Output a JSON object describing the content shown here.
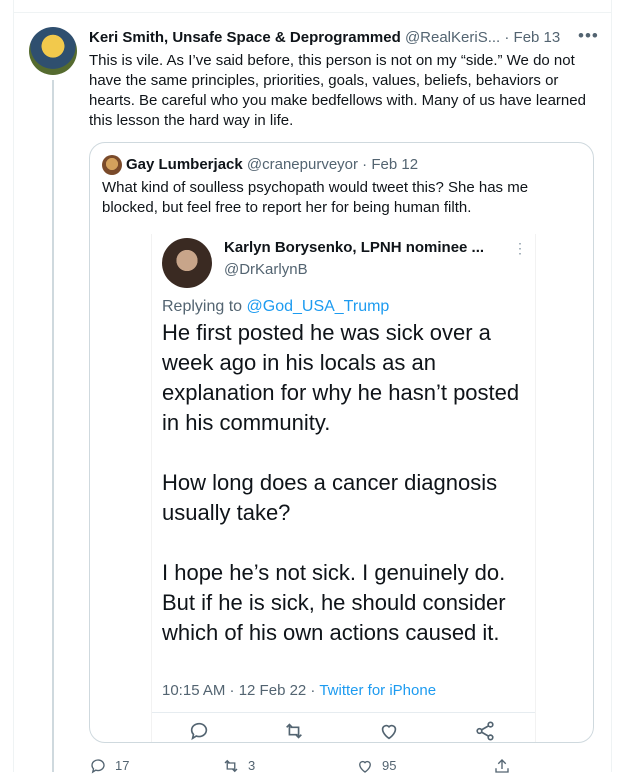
{
  "tweet": {
    "author_name": "Keri Smith, Unsafe Space & Deprogrammed",
    "handle": "@RealKeriS...",
    "dot": "·",
    "date": "Feb 13",
    "text": "This is vile. As I’ve said before, this person is not on my “side.” We do not have the same principles, priorities, goals, values, beliefs, behaviors or hearts. Be careful who you make bedfellows with. Many of us have learned this lesson the hard way in life."
  },
  "quote": {
    "author_name": "Gay Lumberjack",
    "handle": "@cranepurveyor",
    "dot": "·",
    "date": "Feb 12",
    "text": "What kind of soulless psychopath would tweet this? She has me blocked, but feel free to report her for being human filth."
  },
  "screenshot": {
    "author_name": "Karlyn Borysenko, LPNH nominee ...",
    "handle": "@DrKarlynB",
    "replying_prefix": "Replying to",
    "replying_to": "@God_USA_Trump",
    "body": [
      "He first posted he was sick over a week ago in his locals as an explanation for why he hasn’t posted in his community.",
      "How long does a cancer diagnosis usually take?",
      "I hope he’s not sick. I genuinely do. But if he is sick, he should consider which of his own actions caused it."
    ],
    "timestamp": "10:15 AM · 12 Feb 22 ·",
    "source": "Twitter for iPhone",
    "more": "⋮"
  },
  "actions": {
    "reply_count": "17",
    "retweet_count": "3",
    "like_count": "95"
  },
  "icons": {
    "more": "more-horizontal-icon",
    "reply": "reply-icon",
    "retweet": "retweet-icon",
    "like": "heart-icon",
    "share": "share-icon"
  },
  "colors": {
    "accent": "#1d9bf0",
    "secondary_text": "#536471",
    "border": "#cfd9de"
  }
}
